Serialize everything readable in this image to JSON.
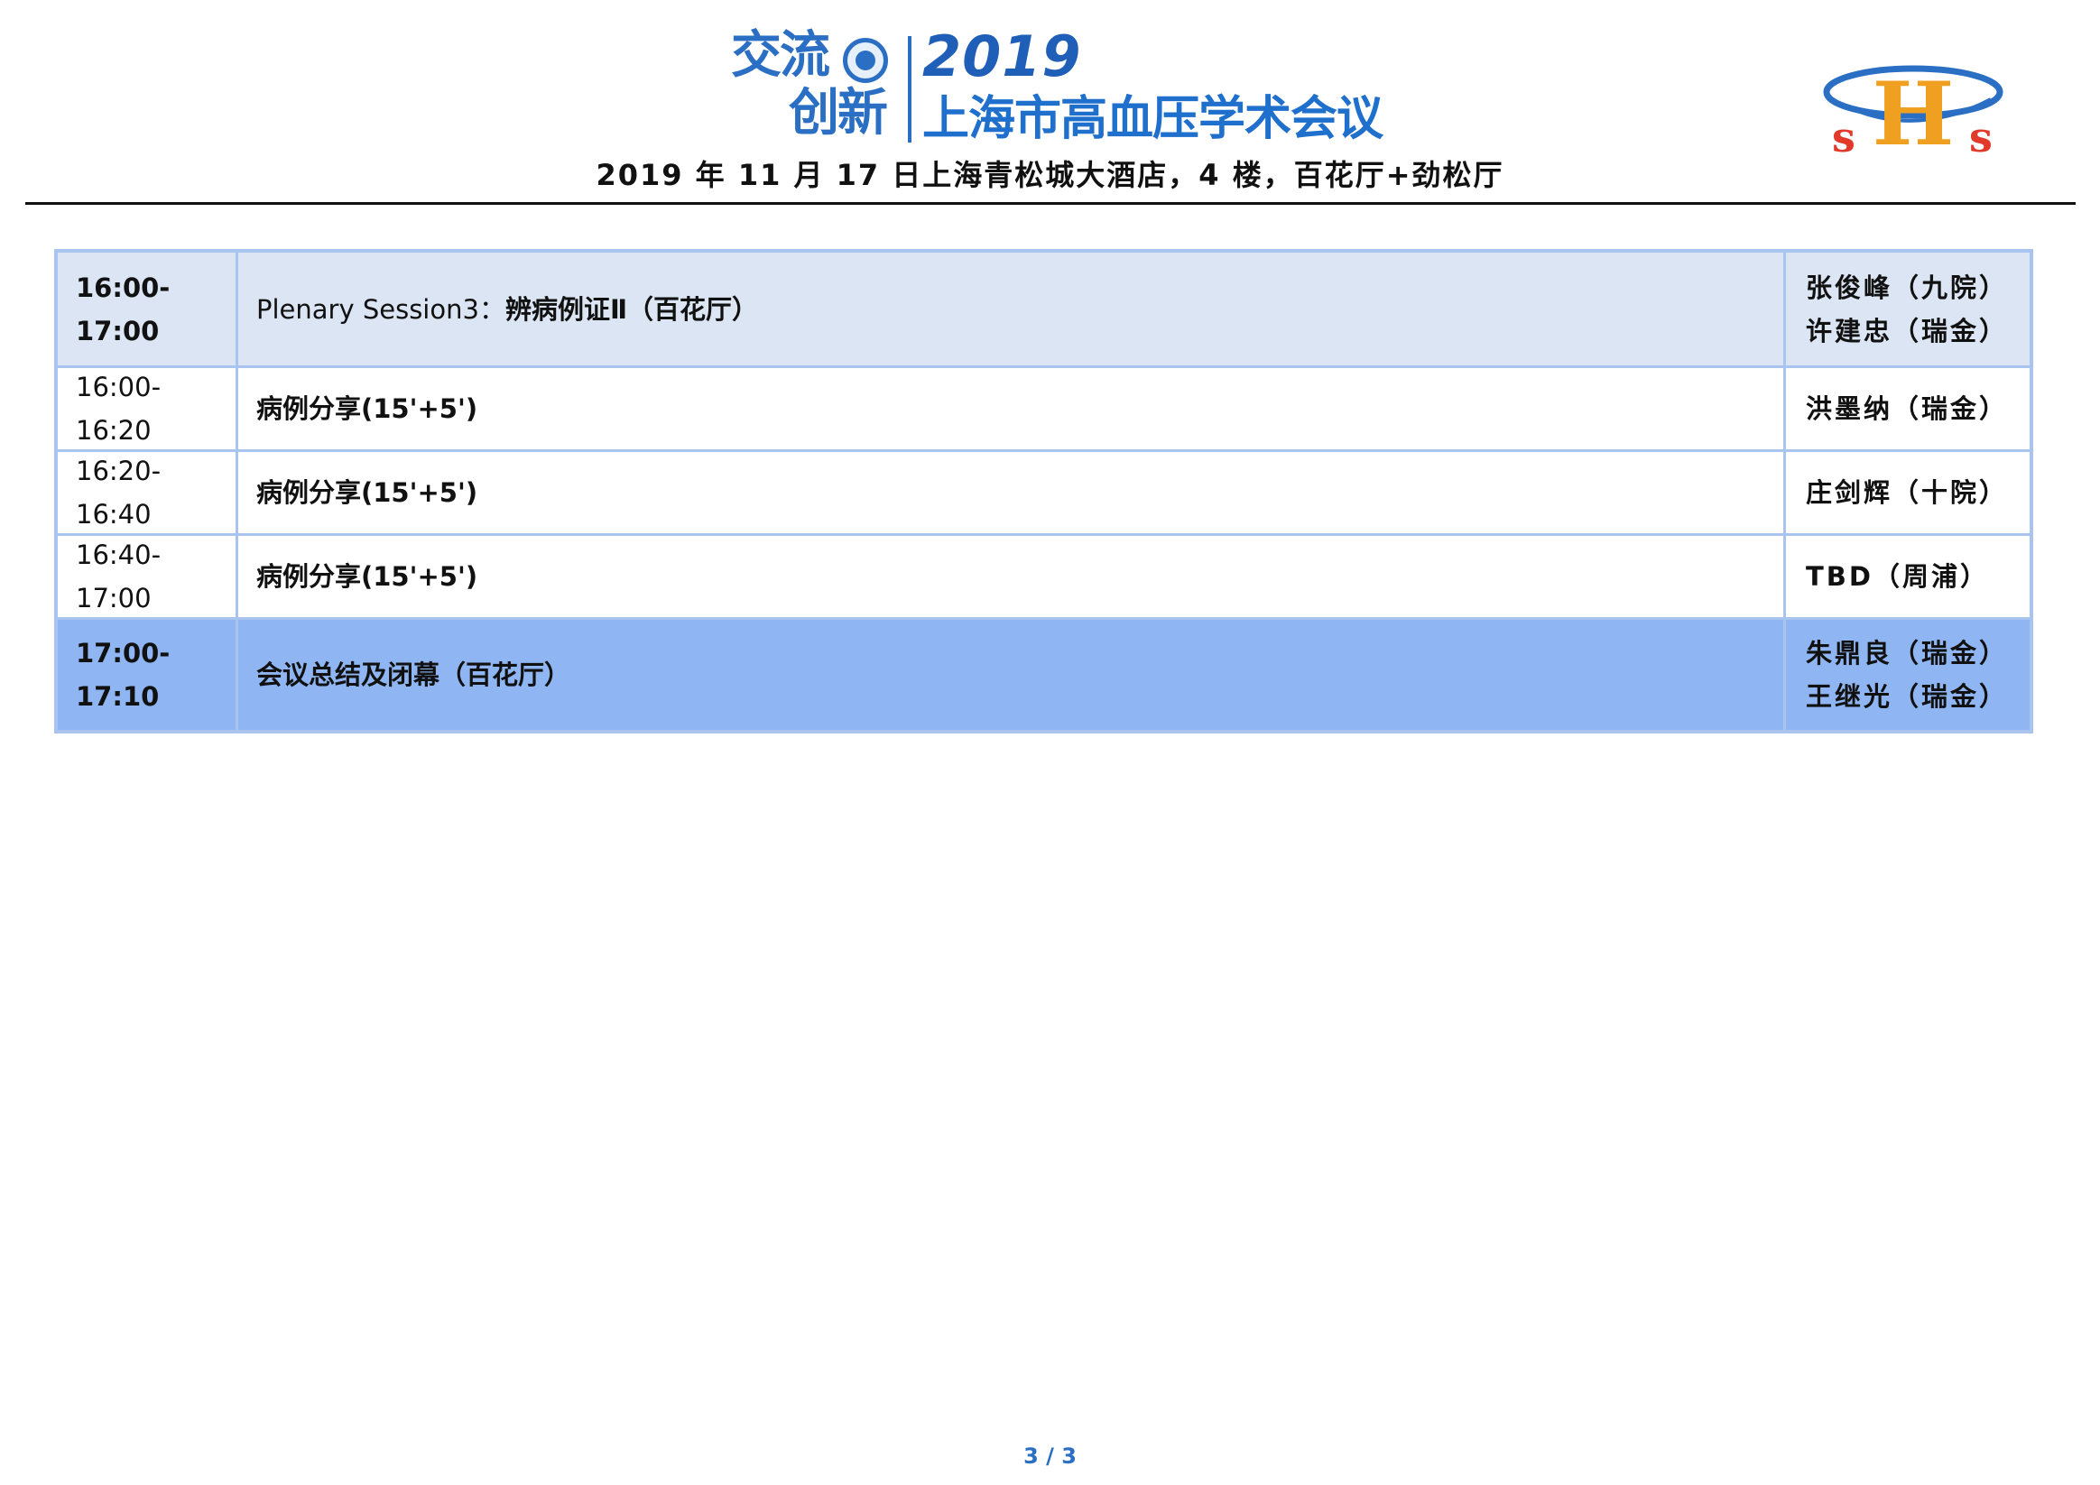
{
  "header": {
    "logo_line1": "交流",
    "logo_line2": "创新",
    "logo_year": "2019",
    "logo_conference": "上海市高血压学术会议",
    "subtitle": "2019 年 11 月 17 日上海青松城大酒店，4 楼，百花厅+劲松厅",
    "shs_letters": "sHs",
    "colors": {
      "brand_blue": "#2a6fc4",
      "shs_red": "#e23a2a",
      "shs_orange": "#f0a020",
      "shs_blue": "#2a6fc4"
    }
  },
  "schedule": {
    "rows": [
      {
        "kind": "session",
        "time": "16:00-17:00",
        "title_en": "Plenary Session3：",
        "title_zh": "辨病例证Ⅱ（百花厅）",
        "speakers": [
          "张俊峰（九院）",
          "许建忠（瑞金）"
        ]
      },
      {
        "kind": "normal",
        "time": "16:00-16:20",
        "title": "病例分享(15'+5')",
        "speakers": [
          "洪墨纳（瑞金）"
        ]
      },
      {
        "kind": "normal",
        "time": "16:20-16:40",
        "title": "病例分享(15'+5')",
        "speakers": [
          "庄剑辉（十院）"
        ]
      },
      {
        "kind": "normal",
        "time": "16:40-17:00",
        "title": "病例分享(15'+5')",
        "speakers": [
          "TBD（周浦）"
        ]
      },
      {
        "kind": "closing",
        "time": "17:00-17:10",
        "title": "会议总结及闭幕（百花厅）",
        "speakers": [
          "朱鼎良（瑞金）",
          "王继光（瑞金）"
        ]
      }
    ],
    "colors": {
      "border": "#a9c4ef",
      "session_bg": "#dbe5f3",
      "closing_bg": "#8fb6f3"
    }
  },
  "footer": {
    "page_number": "3 / 3"
  }
}
